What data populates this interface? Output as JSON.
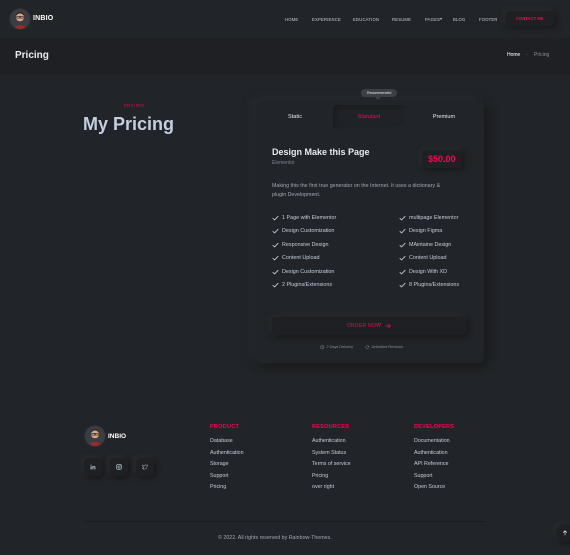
{
  "header": {
    "brand": "INBIO",
    "nav": [
      "HOME",
      "EXPERIENCE",
      "EDUCATION",
      "RESUME",
      "PAGES",
      "BLOG",
      "FOOTER"
    ],
    "pages_caret": "▾",
    "contact_label": "CONTACT ME"
  },
  "titlebar": {
    "title": "Pricing",
    "breadcrumb_home": "Home",
    "breadcrumb_sep": "·",
    "breadcrumb_current": "Pricing"
  },
  "section": {
    "kicker": "PRICING",
    "title": "My Pricing"
  },
  "pricing": {
    "recommended": "Recommended",
    "tabs": [
      "Static",
      "Standard",
      "Premium"
    ],
    "active_tab": "Standard",
    "plan_title": "Design Make this Page",
    "plan_sub": "Elementor",
    "price": "$50.00",
    "description": "Making this the first true generator on the Internet. It uses a dictionary & plugin Development.",
    "features_left": [
      "1 Page with Elementor",
      "Design Customization",
      "Responsive Design",
      "Content Upload",
      "Design Customization",
      "2 Plugins/Extensions"
    ],
    "features_right": [
      "multipage Elementor",
      "Design Figma",
      "MAintaine Design",
      "Content Upload",
      "Design With XD",
      "8 Plugins/Extensions"
    ],
    "order_label": "ORDER NOW",
    "delivery": "2 Days Delivery",
    "revision": "Unlimited Revision"
  },
  "footer": {
    "brand": "INBIO",
    "social_icons": [
      "linkedin-icon",
      "instagram-icon",
      "twitter-icon"
    ],
    "columns": [
      {
        "heading": "PRODUCT",
        "links": [
          "Database",
          "Authentication",
          "Storage",
          "Support",
          "Pricing"
        ]
      },
      {
        "heading": "RESOURCES",
        "links": [
          "Authentication",
          "System Status",
          "Terms of service",
          "Pricing",
          "over right"
        ]
      },
      {
        "heading": "DEVELOPERS",
        "links": [
          "Documentation",
          "Authentication",
          "API Reference",
          "Support",
          "Open Source"
        ]
      }
    ],
    "copyright": "© 2022. All rights reserved by Rainbow-Themes."
  },
  "colors": {
    "background": "#212428",
    "accent": "#ff014f",
    "text": "#c4cfde"
  }
}
